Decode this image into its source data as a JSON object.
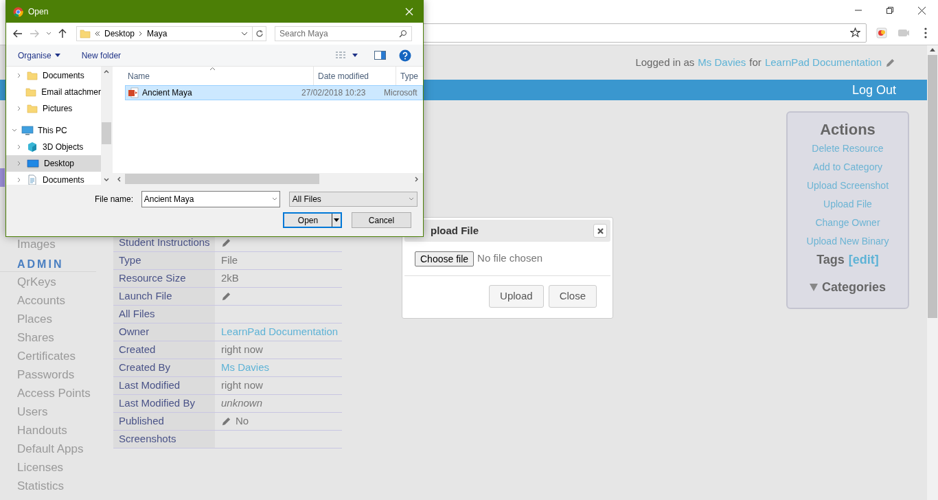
{
  "header": {
    "prefix": "Logged in as",
    "user": "Ms Davies",
    "middle": "for",
    "org": "LearnPad Documentation"
  },
  "nav_bar": {
    "logout": "Log Out"
  },
  "sidebar": {
    "items_above": [
      {
        "label": "Images"
      }
    ],
    "admin_heading": "ADMIN",
    "admin_items": [
      "QrKeys",
      "Accounts",
      "Places",
      "Shares",
      "Certificates",
      "Passwords",
      "Access Points",
      "Users",
      "Handouts",
      "Default Apps",
      "Licenses",
      "Statistics"
    ]
  },
  "details": [
    {
      "label": "Student Instructions",
      "kind": "empty",
      "editable": true
    },
    {
      "label": "Type",
      "value": "File",
      "kind": "text",
      "editable": false
    },
    {
      "label": "Resource Size",
      "value": "2kB",
      "kind": "text",
      "editable": false
    },
    {
      "label": "Launch File",
      "kind": "empty",
      "editable": true
    },
    {
      "label": "All Files",
      "kind": "empty",
      "editable": false
    },
    {
      "label": "Owner",
      "value": "LearnPad Documentation",
      "kind": "link",
      "editable": false
    },
    {
      "label": "Created",
      "value": "right now",
      "kind": "text",
      "editable": false
    },
    {
      "label": "Created By",
      "value": "Ms Davies",
      "kind": "link",
      "editable": false
    },
    {
      "label": "Last Modified",
      "value": "right now",
      "kind": "text",
      "editable": false
    },
    {
      "label": "Last Modified By",
      "value": "unknown",
      "kind": "italic",
      "editable": false
    },
    {
      "label": "Published",
      "value": "No",
      "kind": "text",
      "editable": true
    },
    {
      "label": "Screenshots",
      "kind": "empty",
      "editable": false
    }
  ],
  "upload_modal": {
    "title": "pload File",
    "choose_button": "Choose file",
    "file_status": "No file chosen",
    "buttons": [
      "Upload",
      "Close"
    ]
  },
  "actions": {
    "title": "Actions",
    "links": [
      "Delete Resource",
      "Add to Category",
      "Upload Screenshot",
      "Upload File",
      "Change Owner",
      "Upload New Binary"
    ],
    "tags": "Tags",
    "tags_edit": "[edit]",
    "categories": "Categories",
    "categories_expanded": true
  },
  "dialog": {
    "title": "Open",
    "breadcrumb": [
      "Desktop",
      "Maya"
    ],
    "search": {
      "placeholder": "Search Maya"
    },
    "organise": "Organise",
    "new_folder": "New folder",
    "quick_access": [
      {
        "label": "Documents",
        "expandable": true,
        "selected": false
      },
      {
        "label": "Email attachmer",
        "expandable": false,
        "selected": false
      },
      {
        "label": "Pictures",
        "expandable": true,
        "selected": false
      }
    ],
    "this_pc": {
      "label": "This PC",
      "expanded": true,
      "selected": false,
      "children": [
        {
          "label": "3D Objects",
          "kind": "objects",
          "selected": false
        },
        {
          "label": "Desktop",
          "kind": "desktop",
          "selected": true
        },
        {
          "label": "Documents",
          "kind": "documents",
          "selected": false
        }
      ]
    },
    "columns": [
      "Name",
      "Date modified",
      "Type"
    ],
    "files": [
      {
        "name": "Ancient Maya",
        "date": "27/02/2018 10:23",
        "type": "Microsoft",
        "selected": true
      }
    ],
    "file_name_label": "File name:",
    "file_name": "Ancient Maya",
    "filter": "All Files",
    "buttons": [
      "Open",
      "Cancel"
    ]
  }
}
